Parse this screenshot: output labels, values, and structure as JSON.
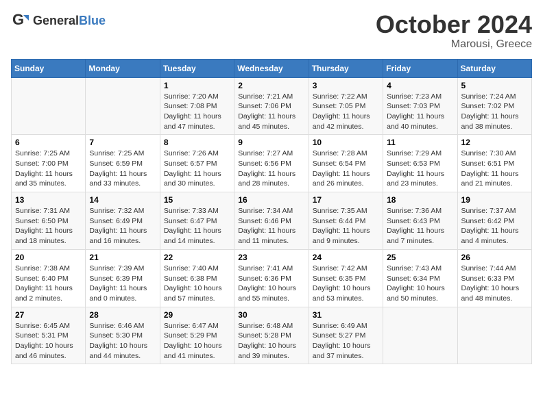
{
  "logo": {
    "general": "General",
    "blue": "Blue"
  },
  "header": {
    "month": "October 2024",
    "location": "Marousi, Greece"
  },
  "weekdays": [
    "Sunday",
    "Monday",
    "Tuesday",
    "Wednesday",
    "Thursday",
    "Friday",
    "Saturday"
  ],
  "weeks": [
    [
      {
        "day": "",
        "info": ""
      },
      {
        "day": "",
        "info": ""
      },
      {
        "day": "1",
        "info": "Sunrise: 7:20 AM\nSunset: 7:08 PM\nDaylight: 11 hours and 47 minutes."
      },
      {
        "day": "2",
        "info": "Sunrise: 7:21 AM\nSunset: 7:06 PM\nDaylight: 11 hours and 45 minutes."
      },
      {
        "day": "3",
        "info": "Sunrise: 7:22 AM\nSunset: 7:05 PM\nDaylight: 11 hours and 42 minutes."
      },
      {
        "day": "4",
        "info": "Sunrise: 7:23 AM\nSunset: 7:03 PM\nDaylight: 11 hours and 40 minutes."
      },
      {
        "day": "5",
        "info": "Sunrise: 7:24 AM\nSunset: 7:02 PM\nDaylight: 11 hours and 38 minutes."
      }
    ],
    [
      {
        "day": "6",
        "info": "Sunrise: 7:25 AM\nSunset: 7:00 PM\nDaylight: 11 hours and 35 minutes."
      },
      {
        "day": "7",
        "info": "Sunrise: 7:25 AM\nSunset: 6:59 PM\nDaylight: 11 hours and 33 minutes."
      },
      {
        "day": "8",
        "info": "Sunrise: 7:26 AM\nSunset: 6:57 PM\nDaylight: 11 hours and 30 minutes."
      },
      {
        "day": "9",
        "info": "Sunrise: 7:27 AM\nSunset: 6:56 PM\nDaylight: 11 hours and 28 minutes."
      },
      {
        "day": "10",
        "info": "Sunrise: 7:28 AM\nSunset: 6:54 PM\nDaylight: 11 hours and 26 minutes."
      },
      {
        "day": "11",
        "info": "Sunrise: 7:29 AM\nSunset: 6:53 PM\nDaylight: 11 hours and 23 minutes."
      },
      {
        "day": "12",
        "info": "Sunrise: 7:30 AM\nSunset: 6:51 PM\nDaylight: 11 hours and 21 minutes."
      }
    ],
    [
      {
        "day": "13",
        "info": "Sunrise: 7:31 AM\nSunset: 6:50 PM\nDaylight: 11 hours and 18 minutes."
      },
      {
        "day": "14",
        "info": "Sunrise: 7:32 AM\nSunset: 6:49 PM\nDaylight: 11 hours and 16 minutes."
      },
      {
        "day": "15",
        "info": "Sunrise: 7:33 AM\nSunset: 6:47 PM\nDaylight: 11 hours and 14 minutes."
      },
      {
        "day": "16",
        "info": "Sunrise: 7:34 AM\nSunset: 6:46 PM\nDaylight: 11 hours and 11 minutes."
      },
      {
        "day": "17",
        "info": "Sunrise: 7:35 AM\nSunset: 6:44 PM\nDaylight: 11 hours and 9 minutes."
      },
      {
        "day": "18",
        "info": "Sunrise: 7:36 AM\nSunset: 6:43 PM\nDaylight: 11 hours and 7 minutes."
      },
      {
        "day": "19",
        "info": "Sunrise: 7:37 AM\nSunset: 6:42 PM\nDaylight: 11 hours and 4 minutes."
      }
    ],
    [
      {
        "day": "20",
        "info": "Sunrise: 7:38 AM\nSunset: 6:40 PM\nDaylight: 11 hours and 2 minutes."
      },
      {
        "day": "21",
        "info": "Sunrise: 7:39 AM\nSunset: 6:39 PM\nDaylight: 11 hours and 0 minutes."
      },
      {
        "day": "22",
        "info": "Sunrise: 7:40 AM\nSunset: 6:38 PM\nDaylight: 10 hours and 57 minutes."
      },
      {
        "day": "23",
        "info": "Sunrise: 7:41 AM\nSunset: 6:36 PM\nDaylight: 10 hours and 55 minutes."
      },
      {
        "day": "24",
        "info": "Sunrise: 7:42 AM\nSunset: 6:35 PM\nDaylight: 10 hours and 53 minutes."
      },
      {
        "day": "25",
        "info": "Sunrise: 7:43 AM\nSunset: 6:34 PM\nDaylight: 10 hours and 50 minutes."
      },
      {
        "day": "26",
        "info": "Sunrise: 7:44 AM\nSunset: 6:33 PM\nDaylight: 10 hours and 48 minutes."
      }
    ],
    [
      {
        "day": "27",
        "info": "Sunrise: 6:45 AM\nSunset: 5:31 PM\nDaylight: 10 hours and 46 minutes."
      },
      {
        "day": "28",
        "info": "Sunrise: 6:46 AM\nSunset: 5:30 PM\nDaylight: 10 hours and 44 minutes."
      },
      {
        "day": "29",
        "info": "Sunrise: 6:47 AM\nSunset: 5:29 PM\nDaylight: 10 hours and 41 minutes."
      },
      {
        "day": "30",
        "info": "Sunrise: 6:48 AM\nSunset: 5:28 PM\nDaylight: 10 hours and 39 minutes."
      },
      {
        "day": "31",
        "info": "Sunrise: 6:49 AM\nSunset: 5:27 PM\nDaylight: 10 hours and 37 minutes."
      },
      {
        "day": "",
        "info": ""
      },
      {
        "day": "",
        "info": ""
      }
    ]
  ]
}
